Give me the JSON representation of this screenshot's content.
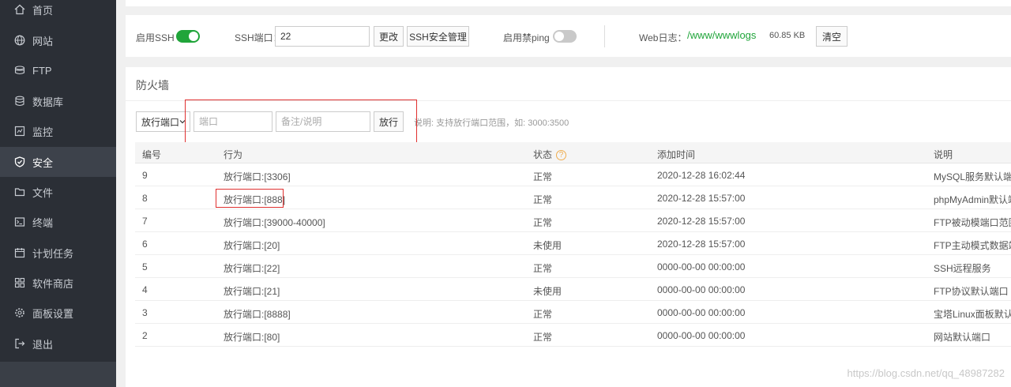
{
  "sidebar": {
    "items": [
      {
        "label": "首页",
        "icon": "home-icon"
      },
      {
        "label": "网站",
        "icon": "globe-icon"
      },
      {
        "label": "FTP",
        "icon": "ftp-icon"
      },
      {
        "label": "数据库",
        "icon": "database-icon"
      },
      {
        "label": "监控",
        "icon": "monitor-icon"
      },
      {
        "label": "安全",
        "icon": "shield-icon",
        "active": true
      },
      {
        "label": "文件",
        "icon": "folder-icon"
      },
      {
        "label": "终端",
        "icon": "terminal-icon"
      },
      {
        "label": "计划任务",
        "icon": "calendar-icon"
      },
      {
        "label": "软件商店",
        "icon": "apps-icon"
      },
      {
        "label": "面板设置",
        "icon": "gear-icon"
      },
      {
        "label": "退出",
        "icon": "logout-icon"
      }
    ]
  },
  "ssh": {
    "enable_label": "启用SSH",
    "enable_on": true,
    "port_label": "SSH端口：",
    "port_value": "22",
    "change_button": "更改",
    "manage_button": "SSH安全管理",
    "ping_label": "启用禁ping",
    "ping_on": false,
    "weblog_label": "Web日志：",
    "weblog_path": "/www/wwwlogs",
    "weblog_size": "60.85 KB",
    "clear_button": "清空"
  },
  "firewall": {
    "title": "防火墙",
    "type_select": "放行端口",
    "port_placeholder": "端口",
    "note_placeholder": "备注/说明",
    "allow_button": "放行",
    "hint": "说明: 支持放行端口范围，如: 3000:3500",
    "columns": {
      "id": "编号",
      "action": "行为",
      "status": "状态",
      "added": "添加时间",
      "note": "说明"
    },
    "rows": [
      {
        "id": "9",
        "action": "放行端口:[3306]",
        "status": "正常",
        "added": "2020-12-28 16:02:44",
        "note": "MySQL服务默认端口"
      },
      {
        "id": "8",
        "action": "放行端口:[888]",
        "status": "正常",
        "added": "2020-12-28 15:57:00",
        "note": "phpMyAdmin默认端"
      },
      {
        "id": "7",
        "action": "放行端口:[39000-40000]",
        "status": "正常",
        "added": "2020-12-28 15:57:00",
        "note": "FTP被动模端口范围"
      },
      {
        "id": "6",
        "action": "放行端口:[20]",
        "status": "未使用",
        "added": "2020-12-28 15:57:00",
        "note": "FTP主动模式数据端"
      },
      {
        "id": "5",
        "action": "放行端口:[22]",
        "status": "正常",
        "added": "0000-00-00 00:00:00",
        "note": "SSH远程服务"
      },
      {
        "id": "4",
        "action": "放行端口:[21]",
        "status": "未使用",
        "added": "0000-00-00 00:00:00",
        "note": "FTP协议默认端口"
      },
      {
        "id": "3",
        "action": "放行端口:[8888]",
        "status": "正常",
        "added": "0000-00-00 00:00:00",
        "note": "宝塔Linux面板默认端"
      },
      {
        "id": "2",
        "action": "放行端口:[80]",
        "status": "正常",
        "added": "0000-00-00 00:00:00",
        "note": "网站默认端口"
      }
    ]
  },
  "watermark": "https://blog.csdn.net/qq_48987282",
  "colors": {
    "sidebar_bg": "#2b2f36",
    "accent_green": "#20a53a",
    "highlight_red": "#e0302f"
  }
}
